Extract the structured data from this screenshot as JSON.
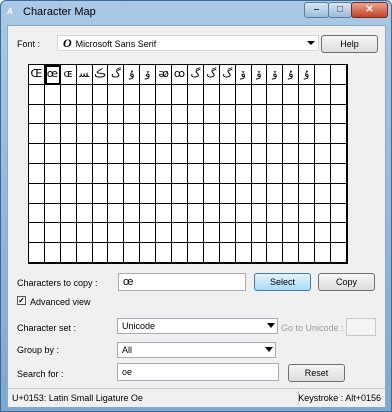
{
  "window": {
    "title": "Character Map",
    "icon": "charmap-app-icon"
  },
  "titlebar_controls": {
    "minimize": "minimize-icon",
    "maximize": "maximize-icon",
    "close": "close-icon"
  },
  "font": {
    "label": "Font :",
    "value": "Microsoft Sans Serif",
    "help_label": "Help"
  },
  "grid": {
    "columns": 20,
    "rows": 10,
    "selected_index": 1,
    "characters": [
      "Œ",
      "œ",
      "ɶ",
      "ﺴ",
      "ڪ",
      "ﮒ",
      "ﯗ",
      "ﯙ",
      "ꭁ",
      "ꝏ",
      "ﮒ",
      "ﮒ",
      "ﮒ",
      "ﯙ",
      "ﯙ",
      "ﯙ",
      "ﯗ",
      "ﯗ",
      "",
      ""
    ]
  },
  "copy": {
    "label": "Characters to copy :",
    "value": "œ",
    "select_label": "Select",
    "copy_label": "Copy"
  },
  "advanced": {
    "label": "Advanced view",
    "checked": true
  },
  "charset": {
    "label": "Character set :",
    "value": "Unicode",
    "goto_label": "Go to Unicode :"
  },
  "groupby": {
    "label": "Group by :",
    "value": "All"
  },
  "search": {
    "label": "Search for :",
    "value": "oe",
    "reset_label": "Reset"
  },
  "status": {
    "left": "U+0153: Latin Small Ligature Oe",
    "right": "Keystroke : Alt+0156"
  },
  "colors": {
    "frame": "#7fa8cf",
    "client": "#f0f0f0",
    "close_button": "#c2452a",
    "active_button": "#a7d9f5"
  }
}
